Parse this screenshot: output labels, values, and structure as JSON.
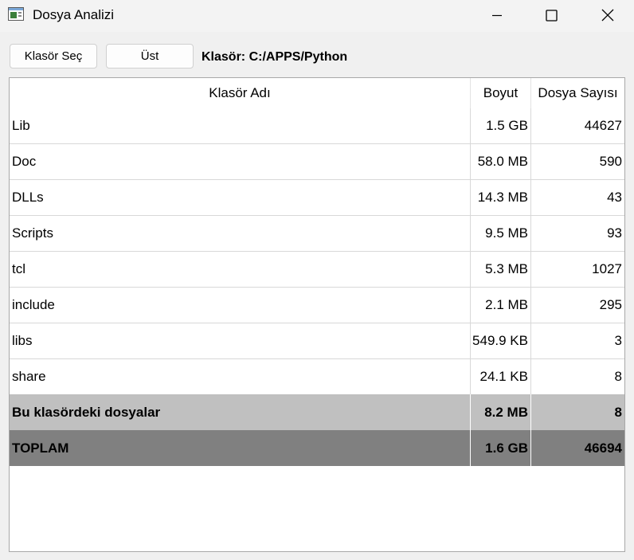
{
  "window": {
    "title": "Dosya Analizi"
  },
  "toolbar": {
    "select_folder_label": "Klasör Seç",
    "up_label": "Üst",
    "current_folder": "Klasör: C:/APPS/Python"
  },
  "table": {
    "columns": [
      "Klasör Adı",
      "Boyut",
      "Dosya Sayısı"
    ],
    "rows": [
      {
        "name": "Lib",
        "size": "1.5 GB",
        "count": "44627"
      },
      {
        "name": "Doc",
        "size": "58.0 MB",
        "count": "590"
      },
      {
        "name": "DLLs",
        "size": "14.3 MB",
        "count": "43"
      },
      {
        "name": "Scripts",
        "size": "9.5 MB",
        "count": "93"
      },
      {
        "name": "tcl",
        "size": "5.3 MB",
        "count": "1027"
      },
      {
        "name": "include",
        "size": "2.1 MB",
        "count": "295"
      },
      {
        "name": "libs",
        "size": "549.9 KB",
        "count": "3"
      },
      {
        "name": "share",
        "size": "24.1 KB",
        "count": "8"
      }
    ],
    "summary": {
      "name": "Bu klasördeki dosyalar",
      "size": "8.2 MB",
      "count": "8"
    },
    "total": {
      "name": "TOPLAM",
      "size": "1.6 GB",
      "count": "46694"
    }
  },
  "colors": {
    "summary_bg": "#c0c0c0",
    "total_bg": "#808080"
  }
}
